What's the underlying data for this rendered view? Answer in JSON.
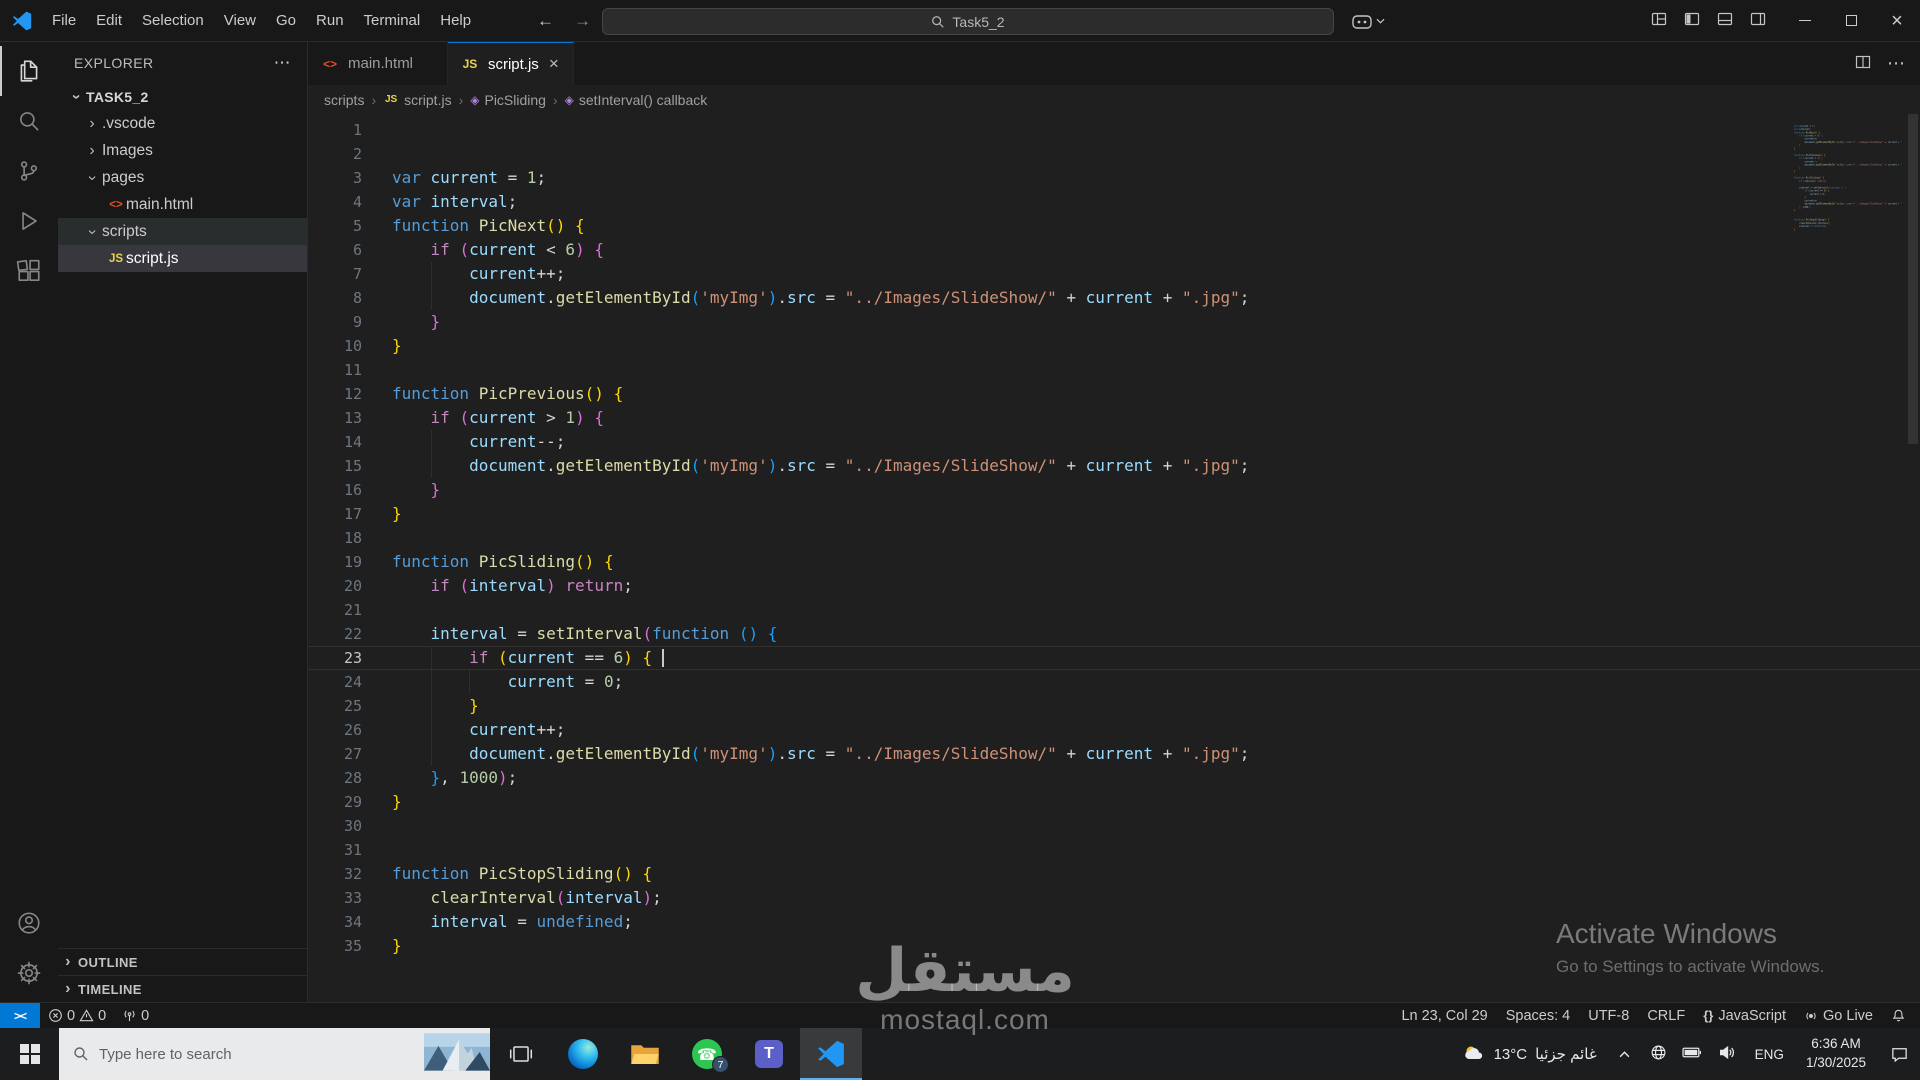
{
  "titlebar": {
    "menus": [
      "File",
      "Edit",
      "Selection",
      "View",
      "Go",
      "Run",
      "Terminal",
      "Help"
    ],
    "search_value": "Task5_2",
    "window_controls": [
      "minimize",
      "maximize",
      "close"
    ]
  },
  "activity_bar": {
    "top": [
      {
        "name": "explorer-icon",
        "active": true
      },
      {
        "name": "search-icon",
        "active": false
      },
      {
        "name": "source-control-icon",
        "active": false
      },
      {
        "name": "run-debug-icon",
        "active": false
      },
      {
        "name": "extensions-icon",
        "active": false
      }
    ],
    "bottom": [
      {
        "name": "account-icon",
        "active": false
      },
      {
        "name": "settings-gear-icon",
        "active": false
      }
    ]
  },
  "sidebar": {
    "header": "EXPLORER",
    "workspace": "TASK5_2",
    "tree": [
      {
        "label": ".vscode",
        "kind": "folder",
        "expanded": false,
        "depth": 0
      },
      {
        "label": "Images",
        "kind": "folder",
        "expanded": false,
        "depth": 0
      },
      {
        "label": "pages",
        "kind": "folder",
        "expanded": true,
        "depth": 0
      },
      {
        "label": "main.html",
        "kind": "html",
        "depth": 1
      },
      {
        "label": "scripts",
        "kind": "folder",
        "expanded": true,
        "depth": 0,
        "highlight": true
      },
      {
        "label": "script.js",
        "kind": "js",
        "depth": 1,
        "selected": true
      }
    ],
    "sections": [
      "OUTLINE",
      "TIMELINE"
    ]
  },
  "editor": {
    "tabs": [
      {
        "label": "main.html",
        "icon": "html",
        "active": false
      },
      {
        "label": "script.js",
        "icon": "js",
        "active": true
      }
    ],
    "breadcrumbs": [
      {
        "label": "scripts"
      },
      {
        "label": "script.js",
        "icon": "js"
      },
      {
        "label": "PicSliding",
        "icon": "symbol"
      },
      {
        "label": "setInterval() callback",
        "icon": "symbol"
      }
    ],
    "active_line": 23,
    "cursor_col": 29,
    "lines": [
      [],
      [],
      [
        [
          "var",
          "k"
        ],
        [
          " current",
          "v"
        ],
        [
          " = ",
          "p"
        ],
        [
          "1",
          "n"
        ],
        [
          ";",
          "p"
        ]
      ],
      [
        [
          "var",
          "k"
        ],
        [
          " interval",
          "v"
        ],
        [
          ";",
          "p"
        ]
      ],
      [
        [
          "function",
          "k"
        ],
        [
          " PicNext",
          "fn"
        ],
        [
          "()",
          "b1"
        ],
        [
          " ",
          "p"
        ],
        [
          "{",
          "b1"
        ]
      ],
      [
        [
          "    ",
          "p"
        ],
        [
          "if",
          "ctrl"
        ],
        [
          " ",
          "p"
        ],
        [
          "(",
          "b2"
        ],
        [
          "current",
          "v"
        ],
        [
          " < ",
          "p"
        ],
        [
          "6",
          "n"
        ],
        [
          ")",
          "b2"
        ],
        [
          " ",
          "p"
        ],
        [
          "{",
          "b2"
        ]
      ],
      [
        [
          "        current",
          "v"
        ],
        [
          "++;",
          "p"
        ]
      ],
      [
        [
          "        document",
          "v"
        ],
        [
          ".",
          "p"
        ],
        [
          "getElementById",
          "fn"
        ],
        [
          "(",
          "b3"
        ],
        [
          "'myImg'",
          "s"
        ],
        [
          ")",
          "b3"
        ],
        [
          ".",
          "p"
        ],
        [
          "src",
          "v"
        ],
        [
          " = ",
          "p"
        ],
        [
          "\"../Images/SlideShow/\"",
          "s"
        ],
        [
          " + ",
          "p"
        ],
        [
          "current",
          "v"
        ],
        [
          " + ",
          "p"
        ],
        [
          "\".jpg\"",
          "s"
        ],
        [
          ";",
          "p"
        ]
      ],
      [
        [
          "    ",
          "p"
        ],
        [
          "}",
          "b2"
        ]
      ],
      [
        [
          "}",
          "b1"
        ]
      ],
      [],
      [
        [
          "function",
          "k"
        ],
        [
          " PicPrevious",
          "fn"
        ],
        [
          "()",
          "b1"
        ],
        [
          " ",
          "p"
        ],
        [
          "{",
          "b1"
        ]
      ],
      [
        [
          "    ",
          "p"
        ],
        [
          "if",
          "ctrl"
        ],
        [
          " ",
          "p"
        ],
        [
          "(",
          "b2"
        ],
        [
          "current",
          "v"
        ],
        [
          " > ",
          "p"
        ],
        [
          "1",
          "n"
        ],
        [
          ")",
          "b2"
        ],
        [
          " ",
          "p"
        ],
        [
          "{",
          "b2"
        ]
      ],
      [
        [
          "        current",
          "v"
        ],
        [
          "--;",
          "p"
        ]
      ],
      [
        [
          "        document",
          "v"
        ],
        [
          ".",
          "p"
        ],
        [
          "getElementById",
          "fn"
        ],
        [
          "(",
          "b3"
        ],
        [
          "'myImg'",
          "s"
        ],
        [
          ")",
          "b3"
        ],
        [
          ".",
          "p"
        ],
        [
          "src",
          "v"
        ],
        [
          " = ",
          "p"
        ],
        [
          "\"../Images/SlideShow/\"",
          "s"
        ],
        [
          " + ",
          "p"
        ],
        [
          "current",
          "v"
        ],
        [
          " + ",
          "p"
        ],
        [
          "\".jpg\"",
          "s"
        ],
        [
          ";",
          "p"
        ]
      ],
      [
        [
          "    ",
          "p"
        ],
        [
          "}",
          "b2"
        ]
      ],
      [
        [
          "}",
          "b1"
        ]
      ],
      [],
      [
        [
          "function",
          "k"
        ],
        [
          " PicSliding",
          "fn"
        ],
        [
          "()",
          "b1"
        ],
        [
          " ",
          "p"
        ],
        [
          "{",
          "b1"
        ]
      ],
      [
        [
          "    ",
          "p"
        ],
        [
          "if",
          "ctrl"
        ],
        [
          " ",
          "p"
        ],
        [
          "(",
          "b2"
        ],
        [
          "interval",
          "v"
        ],
        [
          ")",
          "b2"
        ],
        [
          " ",
          "p"
        ],
        [
          "return",
          "ctrl"
        ],
        [
          ";",
          "p"
        ]
      ],
      [],
      [
        [
          "    interval",
          "v"
        ],
        [
          " = ",
          "p"
        ],
        [
          "setInterval",
          "fn"
        ],
        [
          "(",
          "b2"
        ],
        [
          "function",
          "k"
        ],
        [
          " ",
          "p"
        ],
        [
          "()",
          "b3"
        ],
        [
          " ",
          "p"
        ],
        [
          "{",
          "b3"
        ]
      ],
      [
        [
          "        ",
          "p"
        ],
        [
          "if",
          "ctrl"
        ],
        [
          " ",
          "p"
        ],
        [
          "(",
          "b1"
        ],
        [
          "current",
          "v"
        ],
        [
          " == ",
          "p"
        ],
        [
          "6",
          "n"
        ],
        [
          ")",
          "b1"
        ],
        [
          " ",
          "p"
        ],
        [
          "{",
          "b1"
        ],
        [
          " ",
          "p"
        ]
      ],
      [
        [
          "            current",
          "v"
        ],
        [
          " = ",
          "p"
        ],
        [
          "0",
          "n"
        ],
        [
          ";",
          "p"
        ]
      ],
      [
        [
          "        ",
          "p"
        ],
        [
          "}",
          "b1"
        ]
      ],
      [
        [
          "        current",
          "v"
        ],
        [
          "++;",
          "p"
        ]
      ],
      [
        [
          "        document",
          "v"
        ],
        [
          ".",
          "p"
        ],
        [
          "getElementById",
          "fn"
        ],
        [
          "(",
          "b3"
        ],
        [
          "'myImg'",
          "s"
        ],
        [
          ")",
          "b3"
        ],
        [
          ".",
          "p"
        ],
        [
          "src",
          "v"
        ],
        [
          " = ",
          "p"
        ],
        [
          "\"../Images/SlideShow/\"",
          "s"
        ],
        [
          " + ",
          "p"
        ],
        [
          "current",
          "v"
        ],
        [
          " + ",
          "p"
        ],
        [
          "\".jpg\"",
          "s"
        ],
        [
          ";",
          "p"
        ]
      ],
      [
        [
          "    ",
          "p"
        ],
        [
          "}",
          "b3"
        ],
        [
          ", ",
          "p"
        ],
        [
          "1000",
          "n"
        ],
        [
          ")",
          "b2"
        ],
        [
          ";",
          "p"
        ]
      ],
      [
        [
          "}",
          "b1"
        ]
      ],
      [],
      [],
      [
        [
          "function",
          "k"
        ],
        [
          " PicStopSliding",
          "fn"
        ],
        [
          "()",
          "b1"
        ],
        [
          " ",
          "p"
        ],
        [
          "{",
          "b1"
        ]
      ],
      [
        [
          "    ",
          "p"
        ],
        [
          "clearInterval",
          "fn"
        ],
        [
          "(",
          "b2"
        ],
        [
          "interval",
          "v"
        ],
        [
          ")",
          "b2"
        ],
        [
          ";",
          "p"
        ]
      ],
      [
        [
          "    interval",
          "v"
        ],
        [
          " = ",
          "p"
        ],
        [
          "undefined",
          "k"
        ],
        [
          ";",
          "p"
        ]
      ],
      [
        [
          "}",
          "b1"
        ]
      ]
    ]
  },
  "watermarks": {
    "activate_title": "Activate Windows",
    "activate_sub": "Go to Settings to activate Windows.",
    "brand_arabic": "مستقل",
    "brand_latin": "mostaql.com"
  },
  "status_bar": {
    "remote_icon": "><",
    "errors": "0",
    "warnings": "0",
    "ports": "0",
    "items_right": [
      {
        "name": "cursor-position",
        "label": "Ln 23, Col 29"
      },
      {
        "name": "indentation",
        "label": "Spaces: 4"
      },
      {
        "name": "encoding",
        "label": "UTF-8"
      },
      {
        "name": "eol",
        "label": "CRLF"
      },
      {
        "name": "language-mode",
        "label": "JavaScript",
        "icon": "braces"
      },
      {
        "name": "go-live",
        "label": "Go Live",
        "icon": "broadcast"
      }
    ]
  },
  "taskbar": {
    "search_placeholder": "Type here to search",
    "apps": [
      {
        "name": "task-view",
        "active": false
      },
      {
        "name": "edge",
        "active": false
      },
      {
        "name": "file-explorer",
        "active": false
      },
      {
        "name": "whatsapp",
        "active": false,
        "badge": "7"
      },
      {
        "name": "teams",
        "active": false
      },
      {
        "name": "vscode",
        "active": true
      }
    ],
    "weather": {
      "temp": "13°C",
      "condition": "غائم جزئيا"
    },
    "language": "ENG",
    "time": "6:36 AM",
    "date": "1/30/2025"
  },
  "colors": {
    "accent": "#0078d4",
    "remote_bg": "#0078d4"
  }
}
